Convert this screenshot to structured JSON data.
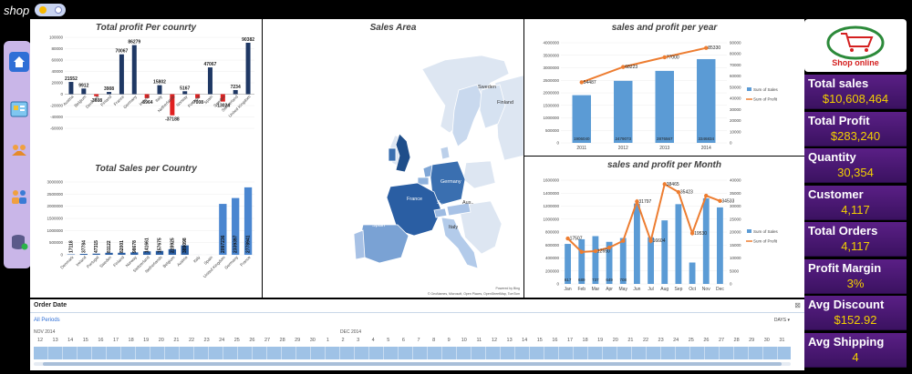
{
  "app": {
    "logo_text": "shop"
  },
  "kpis": [
    {
      "label": "Total sales",
      "value": "$10,608,464"
    },
    {
      "label": "Total Profit",
      "value": "$283,240"
    },
    {
      "label": "Quantity",
      "value": "30,354"
    },
    {
      "label": "Customer",
      "value": "4,117"
    },
    {
      "label": "Total Orders",
      "value": "4,117"
    },
    {
      "label": "Profit Margin",
      "value": "3%"
    },
    {
      "label": "Avg Discount",
      "value": "$152.92"
    },
    {
      "label": "Avg Shipping",
      "value": "4"
    }
  ],
  "brand": {
    "name": "Shop online"
  },
  "map": {
    "title": "Sales Area",
    "countries": [
      "Sweden",
      "Finland",
      "Germany",
      "France",
      "Spain",
      "Italy",
      "Aus..",
      "S.."
    ],
    "credit_top": "Powered by Bing",
    "credit_bottom": "© GeoNames, Microsoft, Open Places, OpenStreetMap, TomTom"
  },
  "timeline": {
    "title": "Order Date",
    "period_label": "All Periods",
    "unit_label": "DAYS",
    "months": [
      "NOV 2014",
      "DEC 2014"
    ],
    "days": [
      "12",
      "13",
      "14",
      "15",
      "16",
      "17",
      "18",
      "19",
      "20",
      "21",
      "22",
      "23",
      "24",
      "25",
      "26",
      "27",
      "28",
      "29",
      "30",
      "1",
      "2",
      "3",
      "4",
      "5",
      "6",
      "7",
      "8",
      "9",
      "10",
      "11",
      "12",
      "13",
      "14",
      "15",
      "16",
      "17",
      "18",
      "19",
      "20",
      "21",
      "22",
      "23",
      "24",
      "25",
      "26",
      "27",
      "28",
      "29",
      "30",
      "31"
    ]
  },
  "chart_data": [
    {
      "type": "bar",
      "title": "Total profit Per counrty",
      "categories": [
        "Austria",
        "Belgium",
        "Denmark",
        "Finland",
        "France",
        "Germany",
        "Ireland",
        "Italy",
        "Netherlands",
        "Norway",
        "Portugal",
        "Spain",
        "Sweden",
        "Switzerland",
        "United Kingdom"
      ],
      "values": [
        21552,
        9912,
        -3608,
        3908,
        70067,
        86279,
        -6964,
        15802,
        -37188,
        5167,
        -7008,
        47067,
        -13024,
        7234,
        90382
      ],
      "labels": [
        "21552",
        "9912",
        "-3608",
        "3908",
        "70067",
        "86279",
        "-6964",
        "15802",
        "-37188",
        "5167",
        "-7008",
        "47067",
        "-13024",
        "7234",
        "90382"
      ],
      "yticks": [
        "100000",
        "80000",
        "60000",
        "40000",
        "20000",
        "0",
        "-20000",
        "-40000",
        "-60000"
      ],
      "ylim": [
        -60000,
        100000
      ],
      "colors": {
        "positive": "#1f3864",
        "negative": "#e02020"
      }
    },
    {
      "type": "bar",
      "title": "Total Sales per Country",
      "categories": [
        "Denmark",
        "Ireland",
        "Portugal",
        "Sweden",
        "Finland",
        "Norway",
        "Switzerland",
        "Netherlands",
        "Belgium",
        "Austria",
        "Italy",
        "Spain",
        "United Kingdom",
        "Germany",
        "France"
      ],
      "values": [
        17118,
        37784,
        47315,
        81122,
        82001,
        98678,
        141661,
        157675,
        228925,
        389098,
        1062,
        1062,
        2097236,
        2339397,
        2778941
      ],
      "labels": [
        "17118",
        "37784",
        "47315",
        "81122",
        "82001",
        "98678",
        "141661",
        "157675",
        "228925",
        "389098",
        "",
        "",
        "2097236",
        "2339397",
        "2778941"
      ],
      "yticks": [
        "3000000",
        "2500000",
        "2000000",
        "1500000",
        "1000000",
        "500000",
        "0"
      ],
      "ylim": [
        0,
        3000000
      ]
    },
    {
      "type": "bar+line",
      "title": "sales and profit per year",
      "categories": [
        "2011",
        "2012",
        "2013",
        "2014"
      ],
      "series": [
        {
          "name": "Sum of Sales",
          "values": [
            1906040,
            2479073,
            2876567,
            3346834
          ],
          "labels": [
            "1906040",
            "2479073",
            "2876567",
            "3346834"
          ],
          "color": "#5b9bd5"
        },
        {
          "name": "Sum of Profit",
          "values": [
            54487,
            68223,
            77000,
            85330
          ],
          "labels": [
            "54487",
            "68223",
            "77000",
            "85330"
          ],
          "color": "#ed7d31"
        }
      ],
      "yticks_left": [
        "4000000",
        "3500000",
        "3000000",
        "2500000",
        "2000000",
        "1500000",
        "1000000",
        "500000",
        "0"
      ],
      "yticks_right": [
        "90000",
        "80000",
        "70000",
        "60000",
        "50000",
        "40000",
        "30000",
        "20000",
        "10000",
        "0"
      ],
      "ylim_left": [
        0,
        4000000
      ],
      "ylim_right": [
        0,
        90000
      ]
    },
    {
      "type": "bar+line",
      "title": "sales and profit per Month",
      "categories": [
        "Jan",
        "Feb",
        "Mar",
        "Apr",
        "May",
        "Jun",
        "Jul",
        "Aug",
        "Sep",
        "Oct",
        "Nov",
        "Dec"
      ],
      "series": [
        {
          "name": "Sum of Sales",
          "values": [
            617000,
            689000,
            737000,
            649000,
            708000,
            1240000,
            720000,
            980000,
            1230000,
            330000,
            1320000,
            1180000
          ],
          "labels": [
            "617",
            "689",
            "737",
            "649",
            "708",
            "",
            "",
            "",
            "",
            "",
            "",
            ""
          ],
          "color": "#5b9bd5"
        },
        {
          "name": "Sum of Profit",
          "values": [
            17507,
            12333,
            12650,
            14000,
            16600,
            31797,
            16604,
            38465,
            35423,
            19530,
            34000,
            32000
          ],
          "labels": [
            "17507",
            "",
            "12650",
            "",
            "",
            "31797",
            "16604",
            "38465",
            "35423",
            "19530",
            "",
            "34533"
          ],
          "color": "#ed7d31"
        }
      ],
      "yticks_left": [
        "1600000",
        "1400000",
        "1200000",
        "1000000",
        "800000",
        "600000",
        "400000",
        "200000",
        "0"
      ],
      "yticks_right": [
        "40000",
        "35000",
        "30000",
        "25000",
        "20000",
        "15000",
        "10000",
        "5000",
        "0"
      ],
      "ylim_left": [
        0,
        1600000
      ],
      "ylim_right": [
        0,
        40000
      ]
    }
  ]
}
